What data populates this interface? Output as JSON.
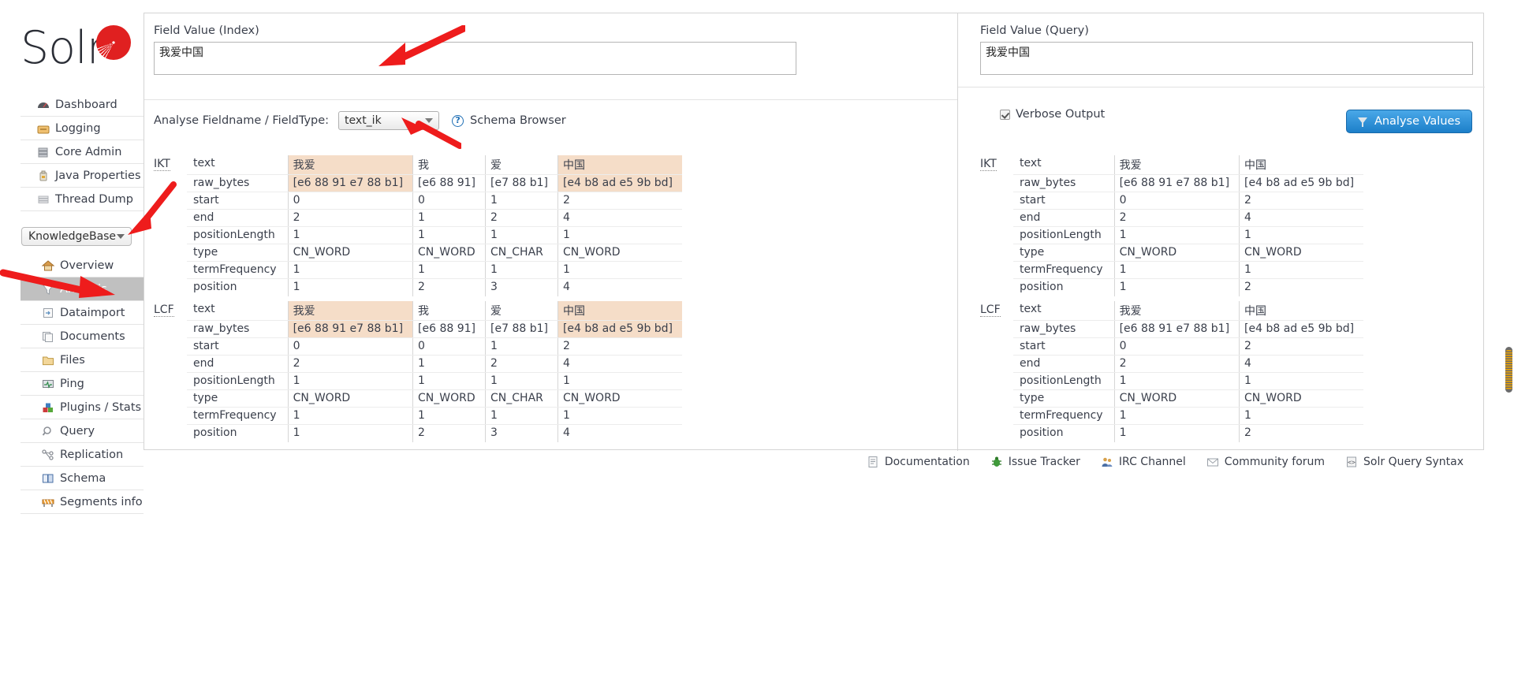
{
  "app": {
    "logo_text": "Solr",
    "logo_icon": "solr-sun-logo"
  },
  "sidebar": {
    "top_items": [
      {
        "label": "Dashboard",
        "icon": "dashboard-icon"
      },
      {
        "label": "Logging",
        "icon": "logging-icon"
      },
      {
        "label": "Core Admin",
        "icon": "core-admin-icon"
      },
      {
        "label": "Java Properties",
        "icon": "java-properties-icon"
      },
      {
        "label": "Thread Dump",
        "icon": "thread-dump-icon"
      }
    ],
    "core_selector": {
      "value": "KnowledgeBase",
      "caret_icon": "chevron-down-icon"
    },
    "core_items": [
      {
        "label": "Overview",
        "icon": "home-icon",
        "active": false
      },
      {
        "label": "Analysis",
        "icon": "funnel-icon",
        "active": true
      },
      {
        "label": "Dataimport",
        "icon": "dataimport-icon",
        "active": false
      },
      {
        "label": "Documents",
        "icon": "documents-icon",
        "active": false
      },
      {
        "label": "Files",
        "icon": "folder-icon",
        "active": false
      },
      {
        "label": "Ping",
        "icon": "ping-icon",
        "active": false
      },
      {
        "label": "Plugins / Stats",
        "icon": "plugins-icon",
        "active": false
      },
      {
        "label": "Query",
        "icon": "magnifier-icon",
        "active": false
      },
      {
        "label": "Replication",
        "icon": "replication-icon",
        "active": false
      },
      {
        "label": "Schema",
        "icon": "book-icon",
        "active": false
      },
      {
        "label": "Segments info",
        "icon": "segments-icon",
        "active": false
      }
    ]
  },
  "form": {
    "index_label": "Field Value (Index)",
    "index_value": "我爱中国",
    "index_placeholder": "",
    "query_label": "Field Value (Query)",
    "query_value": "我爱中国",
    "query_placeholder": "",
    "analyse_fieldname_label": "Analyse Fieldname / FieldType:",
    "fieldtype_value": "text_ik",
    "help_icon": "question-mark-icon",
    "schema_browser_link": "Schema Browser",
    "verbose_label": "Verbose Output",
    "verbose_checked": true,
    "analyse_button": "Analyse Values",
    "analyse_button_icon": "funnel-icon",
    "accent_color": "#1c7fc9",
    "highlight_color": "#f5ddc8"
  },
  "analysis": {
    "row_headers": [
      "text",
      "raw_bytes",
      "start",
      "end",
      "positionLength",
      "type",
      "termFrequency",
      "position"
    ],
    "index": [
      {
        "tag": "IKT",
        "columns": [
          {
            "highlight": true,
            "cells": [
              "我爱",
              "[e6 88 91 e7 88 b1]",
              "0",
              "2",
              "1",
              "CN_WORD",
              "1",
              "1"
            ]
          },
          {
            "highlight": false,
            "cells": [
              "我",
              "[e6 88 91]",
              "0",
              "1",
              "1",
              "CN_WORD",
              "1",
              "2"
            ]
          },
          {
            "highlight": false,
            "cells": [
              "爱",
              "[e7 88 b1]",
              "1",
              "2",
              "1",
              "CN_CHAR",
              "1",
              "3"
            ]
          },
          {
            "highlight": true,
            "cells": [
              "中国",
              "[e4 b8 ad e5 9b bd]",
              "2",
              "4",
              "1",
              "CN_WORD",
              "1",
              "4"
            ]
          }
        ]
      },
      {
        "tag": "LCF",
        "columns": [
          {
            "highlight": true,
            "cells": [
              "我爱",
              "[e6 88 91 e7 88 b1]",
              "0",
              "2",
              "1",
              "CN_WORD",
              "1",
              "1"
            ]
          },
          {
            "highlight": false,
            "cells": [
              "我",
              "[e6 88 91]",
              "0",
              "1",
              "1",
              "CN_WORD",
              "1",
              "2"
            ]
          },
          {
            "highlight": false,
            "cells": [
              "爱",
              "[e7 88 b1]",
              "1",
              "2",
              "1",
              "CN_CHAR",
              "1",
              "3"
            ]
          },
          {
            "highlight": true,
            "cells": [
              "中国",
              "[e4 b8 ad e5 9b bd]",
              "2",
              "4",
              "1",
              "CN_WORD",
              "1",
              "4"
            ]
          }
        ]
      }
    ],
    "query": [
      {
        "tag": "IKT",
        "columns": [
          {
            "highlight": false,
            "cells": [
              "我爱",
              "[e6 88 91 e7 88 b1]",
              "0",
              "2",
              "1",
              "CN_WORD",
              "1",
              "1"
            ]
          },
          {
            "highlight": false,
            "cells": [
              "中国",
              "[e4 b8 ad e5 9b bd]",
              "2",
              "4",
              "1",
              "CN_WORD",
              "1",
              "2"
            ]
          }
        ]
      },
      {
        "tag": "LCF",
        "columns": [
          {
            "highlight": false,
            "cells": [
              "我爱",
              "[e6 88 91 e7 88 b1]",
              "0",
              "2",
              "1",
              "CN_WORD",
              "1",
              "1"
            ]
          },
          {
            "highlight": false,
            "cells": [
              "中国",
              "[e4 b8 ad e5 9b bd]",
              "2",
              "4",
              "1",
              "CN_WORD",
              "1",
              "2"
            ]
          }
        ]
      }
    ]
  },
  "footer": {
    "links": [
      {
        "label": "Documentation",
        "icon": "document-icon"
      },
      {
        "label": "Issue Tracker",
        "icon": "bug-icon"
      },
      {
        "label": "IRC Channel",
        "icon": "people-icon"
      },
      {
        "label": "Community forum",
        "icon": "envelope-icon"
      },
      {
        "label": "Solr Query Syntax",
        "icon": "code-icon"
      }
    ]
  },
  "annotations": {
    "arrow_color": "#ee1c1c",
    "arrow_count": 4
  }
}
